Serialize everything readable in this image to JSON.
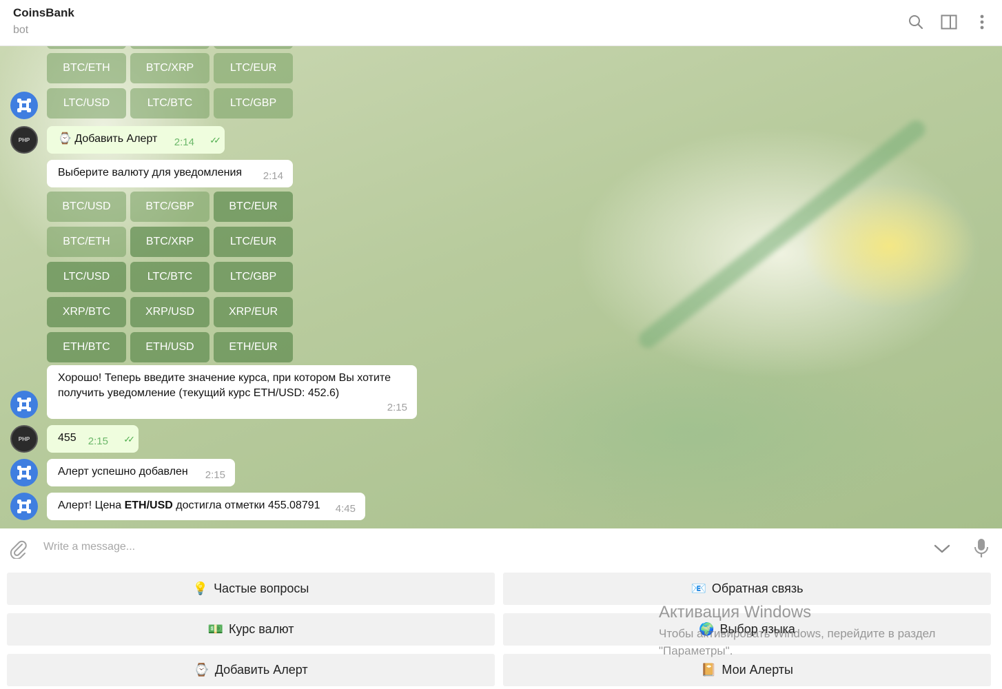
{
  "header": {
    "title": "CoinsBank",
    "subtitle": "bot",
    "icons": [
      "search-icon",
      "sidebar-toggle-icon",
      "more-vertical-icon"
    ]
  },
  "keyboard_top": [
    [
      "BTC/ETH",
      "BTC/XRP",
      "LTC/EUR"
    ],
    [
      "LTC/USD",
      "LTC/BTC",
      "LTC/GBP"
    ]
  ],
  "messages": {
    "add_alert_out": {
      "emoji": "⌚",
      "text": "Добавить Алерт",
      "time": "2:14"
    },
    "choose_currency": {
      "text": "Выберите валюту для уведомления",
      "time": "2:14"
    },
    "enter_rate": {
      "text": "Хорошо! Теперь введите значение курса, при котором Вы хотите получить уведомление (текущий курс ETH/USD: 452.6)",
      "time": "2:15"
    },
    "value_out": {
      "text": "455",
      "time": "2:15"
    },
    "alert_added": {
      "text": "Алерт успешно добавлен",
      "time": "2:15"
    },
    "alert_fired": {
      "prefix": "Алерт! Цена ",
      "pair": "ETH/USD",
      "suffix": " достигла отметки 455.08791",
      "time": "4:45"
    }
  },
  "keyboard_main": [
    [
      "BTC/USD",
      "BTC/GBP",
      "BTC/EUR"
    ],
    [
      "BTC/ETH",
      "BTC/XRP",
      "LTC/EUR"
    ],
    [
      "LTC/USD",
      "LTC/BTC",
      "LTC/GBP"
    ],
    [
      "XRP/BTC",
      "XRP/USD",
      "XRP/EUR"
    ],
    [
      "ETH/BTC",
      "ETH/USD",
      "ETH/EUR"
    ]
  ],
  "user_avatar_label": "PHP",
  "input": {
    "placeholder": "Write a message..."
  },
  "reply_keyboard": [
    {
      "emoji": "💡",
      "label": "Частые вопросы"
    },
    {
      "emoji": "📧",
      "label": "Обратная связь"
    },
    {
      "emoji": "💵",
      "label": "Курс валют"
    },
    {
      "emoji": "🌍",
      "label": "Выбор языка"
    },
    {
      "emoji": "⌚",
      "label": "Добавить Алерт"
    },
    {
      "emoji": "📔",
      "label": "Мои Алерты"
    }
  ],
  "watermark": {
    "title": "Активация Windows",
    "subtitle": "Чтобы активировать Windows, перейдите в раздел \"Параметры\"."
  },
  "colors": {
    "bot_avatar": "#3f7ee0",
    "keyboard_button": "#5f8c50",
    "outgoing_bubble": "#effdde",
    "read_check": "#4fae4e"
  }
}
